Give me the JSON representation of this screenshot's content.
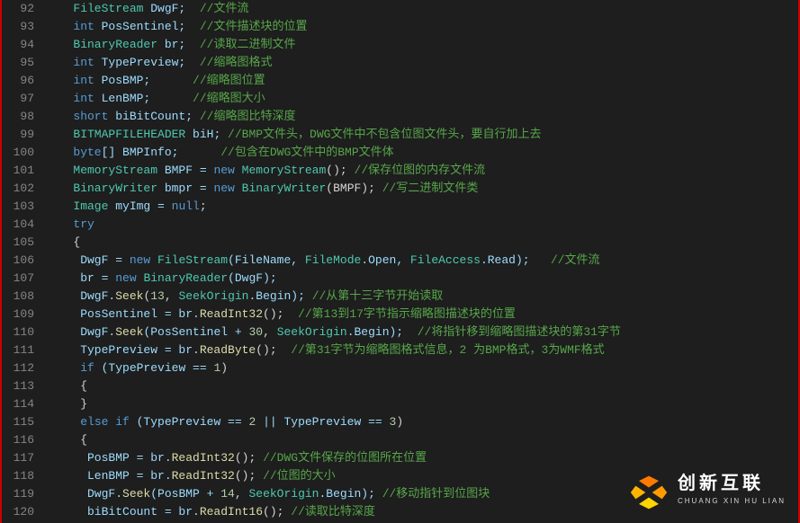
{
  "gutter": {
    "start": 92,
    "end": 120
  },
  "lines": [
    [
      {
        "t": "   ",
        "c": ""
      },
      {
        "t": "FileStream",
        "c": "cls"
      },
      {
        "t": " DwgF;  ",
        "c": "ident"
      },
      {
        "t": "//文件流",
        "c": "comment"
      }
    ],
    [
      {
        "t": "   ",
        "c": ""
      },
      {
        "t": "int",
        "c": "kw"
      },
      {
        "t": " PosSentinel;  ",
        "c": "ident"
      },
      {
        "t": "//文件描述块的位置",
        "c": "comment"
      }
    ],
    [
      {
        "t": "   ",
        "c": ""
      },
      {
        "t": "BinaryReader",
        "c": "cls"
      },
      {
        "t": " br;  ",
        "c": "ident"
      },
      {
        "t": "//读取二进制文件",
        "c": "comment"
      }
    ],
    [
      {
        "t": "   ",
        "c": ""
      },
      {
        "t": "int",
        "c": "kw"
      },
      {
        "t": " TypePreview;  ",
        "c": "ident"
      },
      {
        "t": "//缩略图格式",
        "c": "comment"
      }
    ],
    [
      {
        "t": "   ",
        "c": ""
      },
      {
        "t": "int",
        "c": "kw"
      },
      {
        "t": " PosBMP;      ",
        "c": "ident"
      },
      {
        "t": "//缩略图位置",
        "c": "comment"
      }
    ],
    [
      {
        "t": "   ",
        "c": ""
      },
      {
        "t": "int",
        "c": "kw"
      },
      {
        "t": " LenBMP;      ",
        "c": "ident"
      },
      {
        "t": "//缩略图大小",
        "c": "comment"
      }
    ],
    [
      {
        "t": "   ",
        "c": ""
      },
      {
        "t": "short",
        "c": "kw"
      },
      {
        "t": " biBitCount; ",
        "c": "ident"
      },
      {
        "t": "//缩略图比特深度",
        "c": "comment"
      }
    ],
    [
      {
        "t": "   ",
        "c": ""
      },
      {
        "t": "BITMAPFILEHEADER",
        "c": "cls"
      },
      {
        "t": " biH; ",
        "c": "ident"
      },
      {
        "t": "//BMP文件头，DWG文件中不包含位图文件头，要自行加上去",
        "c": "comment"
      }
    ],
    [
      {
        "t": "   ",
        "c": ""
      },
      {
        "t": "byte",
        "c": "kw"
      },
      {
        "t": "[] BMPInfo;      ",
        "c": "ident"
      },
      {
        "t": "//包含在DWG文件中的BMP文件体",
        "c": "comment"
      }
    ],
    [
      {
        "t": "   ",
        "c": ""
      },
      {
        "t": "MemoryStream",
        "c": "cls"
      },
      {
        "t": " BMPF = ",
        "c": "ident"
      },
      {
        "t": "new",
        "c": "kw"
      },
      {
        "t": " ",
        "c": ""
      },
      {
        "t": "MemoryStream",
        "c": "cls"
      },
      {
        "t": "(); ",
        "c": "punc"
      },
      {
        "t": "//保存位图的内存文件流",
        "c": "comment"
      }
    ],
    [
      {
        "t": "   ",
        "c": ""
      },
      {
        "t": "BinaryWriter",
        "c": "cls"
      },
      {
        "t": " bmpr = ",
        "c": "ident"
      },
      {
        "t": "new",
        "c": "kw"
      },
      {
        "t": " ",
        "c": ""
      },
      {
        "t": "BinaryWriter",
        "c": "cls"
      },
      {
        "t": "(BMPF); ",
        "c": "punc"
      },
      {
        "t": "//写二进制文件类",
        "c": "comment"
      }
    ],
    [
      {
        "t": "   ",
        "c": ""
      },
      {
        "t": "Image",
        "c": "cls"
      },
      {
        "t": " myImg = ",
        "c": "ident"
      },
      {
        "t": "null",
        "c": "kw"
      },
      {
        "t": ";",
        "c": "punc"
      }
    ],
    [
      {
        "t": "   ",
        "c": ""
      },
      {
        "t": "try",
        "c": "kw"
      }
    ],
    [
      {
        "t": "   {",
        "c": "punc"
      }
    ],
    [
      {
        "t": "    DwgF = ",
        "c": "ident"
      },
      {
        "t": "new",
        "c": "kw"
      },
      {
        "t": " ",
        "c": ""
      },
      {
        "t": "FileStream",
        "c": "cls"
      },
      {
        "t": "(FileName, ",
        "c": "ident"
      },
      {
        "t": "FileMode",
        "c": "cls"
      },
      {
        "t": ".Open, ",
        "c": "ident"
      },
      {
        "t": "FileAccess",
        "c": "cls"
      },
      {
        "t": ".Read);   ",
        "c": "ident"
      },
      {
        "t": "//文件流",
        "c": "comment"
      }
    ],
    [
      {
        "t": "    br = ",
        "c": "ident"
      },
      {
        "t": "new",
        "c": "kw"
      },
      {
        "t": " ",
        "c": ""
      },
      {
        "t": "BinaryReader",
        "c": "cls"
      },
      {
        "t": "(DwgF);",
        "c": "ident"
      }
    ],
    [
      {
        "t": "    DwgF.",
        "c": "ident"
      },
      {
        "t": "Seek",
        "c": "func"
      },
      {
        "t": "(",
        "c": "punc"
      },
      {
        "t": "13",
        "c": "num"
      },
      {
        "t": ", ",
        "c": "punc"
      },
      {
        "t": "SeekOrigin",
        "c": "cls"
      },
      {
        "t": ".Begin); ",
        "c": "ident"
      },
      {
        "t": "//从第十三字节开始读取",
        "c": "comment"
      }
    ],
    [
      {
        "t": "    PosSentinel = br.",
        "c": "ident"
      },
      {
        "t": "ReadInt32",
        "c": "func"
      },
      {
        "t": "();  ",
        "c": "punc"
      },
      {
        "t": "//第13到17字节指示缩略图描述块的位置",
        "c": "comment"
      }
    ],
    [
      {
        "t": "    DwgF.",
        "c": "ident"
      },
      {
        "t": "Seek",
        "c": "func"
      },
      {
        "t": "(PosSentinel + ",
        "c": "ident"
      },
      {
        "t": "30",
        "c": "num"
      },
      {
        "t": ", ",
        "c": "punc"
      },
      {
        "t": "SeekOrigin",
        "c": "cls"
      },
      {
        "t": ".Begin);  ",
        "c": "ident"
      },
      {
        "t": "//将指针移到缩略图描述块的第31字节",
        "c": "comment"
      }
    ],
    [
      {
        "t": "    TypePreview = br.",
        "c": "ident"
      },
      {
        "t": "ReadByte",
        "c": "func"
      },
      {
        "t": "();  ",
        "c": "punc"
      },
      {
        "t": "//第31字节为缩略图格式信息，2 为BMP格式，3为WMF格式",
        "c": "comment"
      }
    ],
    [
      {
        "t": "    ",
        "c": ""
      },
      {
        "t": "if",
        "c": "kw"
      },
      {
        "t": " (TypePreview == ",
        "c": "ident"
      },
      {
        "t": "1",
        "c": "num"
      },
      {
        "t": ")",
        "c": "punc"
      }
    ],
    [
      {
        "t": "    {",
        "c": "punc"
      }
    ],
    [
      {
        "t": "    }",
        "c": "punc"
      }
    ],
    [
      {
        "t": "    ",
        "c": ""
      },
      {
        "t": "else if",
        "c": "kw"
      },
      {
        "t": " (TypePreview == ",
        "c": "ident"
      },
      {
        "t": "2",
        "c": "num"
      },
      {
        "t": " || TypePreview == ",
        "c": "ident"
      },
      {
        "t": "3",
        "c": "num"
      },
      {
        "t": ")",
        "c": "punc"
      }
    ],
    [
      {
        "t": "    {",
        "c": "punc"
      }
    ],
    [
      {
        "t": "     PosBMP = br.",
        "c": "ident"
      },
      {
        "t": "ReadInt32",
        "c": "func"
      },
      {
        "t": "(); ",
        "c": "punc"
      },
      {
        "t": "//DWG文件保存的位图所在位置",
        "c": "comment"
      }
    ],
    [
      {
        "t": "     LenBMP = br.",
        "c": "ident"
      },
      {
        "t": "ReadInt32",
        "c": "func"
      },
      {
        "t": "(); ",
        "c": "punc"
      },
      {
        "t": "//位图的大小",
        "c": "comment"
      }
    ],
    [
      {
        "t": "     DwgF.",
        "c": "ident"
      },
      {
        "t": "Seek",
        "c": "func"
      },
      {
        "t": "(PosBMP + ",
        "c": "ident"
      },
      {
        "t": "14",
        "c": "num"
      },
      {
        "t": ", ",
        "c": "punc"
      },
      {
        "t": "SeekOrigin",
        "c": "cls"
      },
      {
        "t": ".Begin); ",
        "c": "ident"
      },
      {
        "t": "//移动指针到位图块",
        "c": "comment"
      }
    ],
    [
      {
        "t": "     biBitCount = br.",
        "c": "ident"
      },
      {
        "t": "ReadInt16",
        "c": "func"
      },
      {
        "t": "(); ",
        "c": "punc"
      },
      {
        "t": "//读取比特深度",
        "c": "comment"
      }
    ]
  ],
  "logo": {
    "cn": "创新互联",
    "en": "CHUANG XIN HU LIAN"
  }
}
